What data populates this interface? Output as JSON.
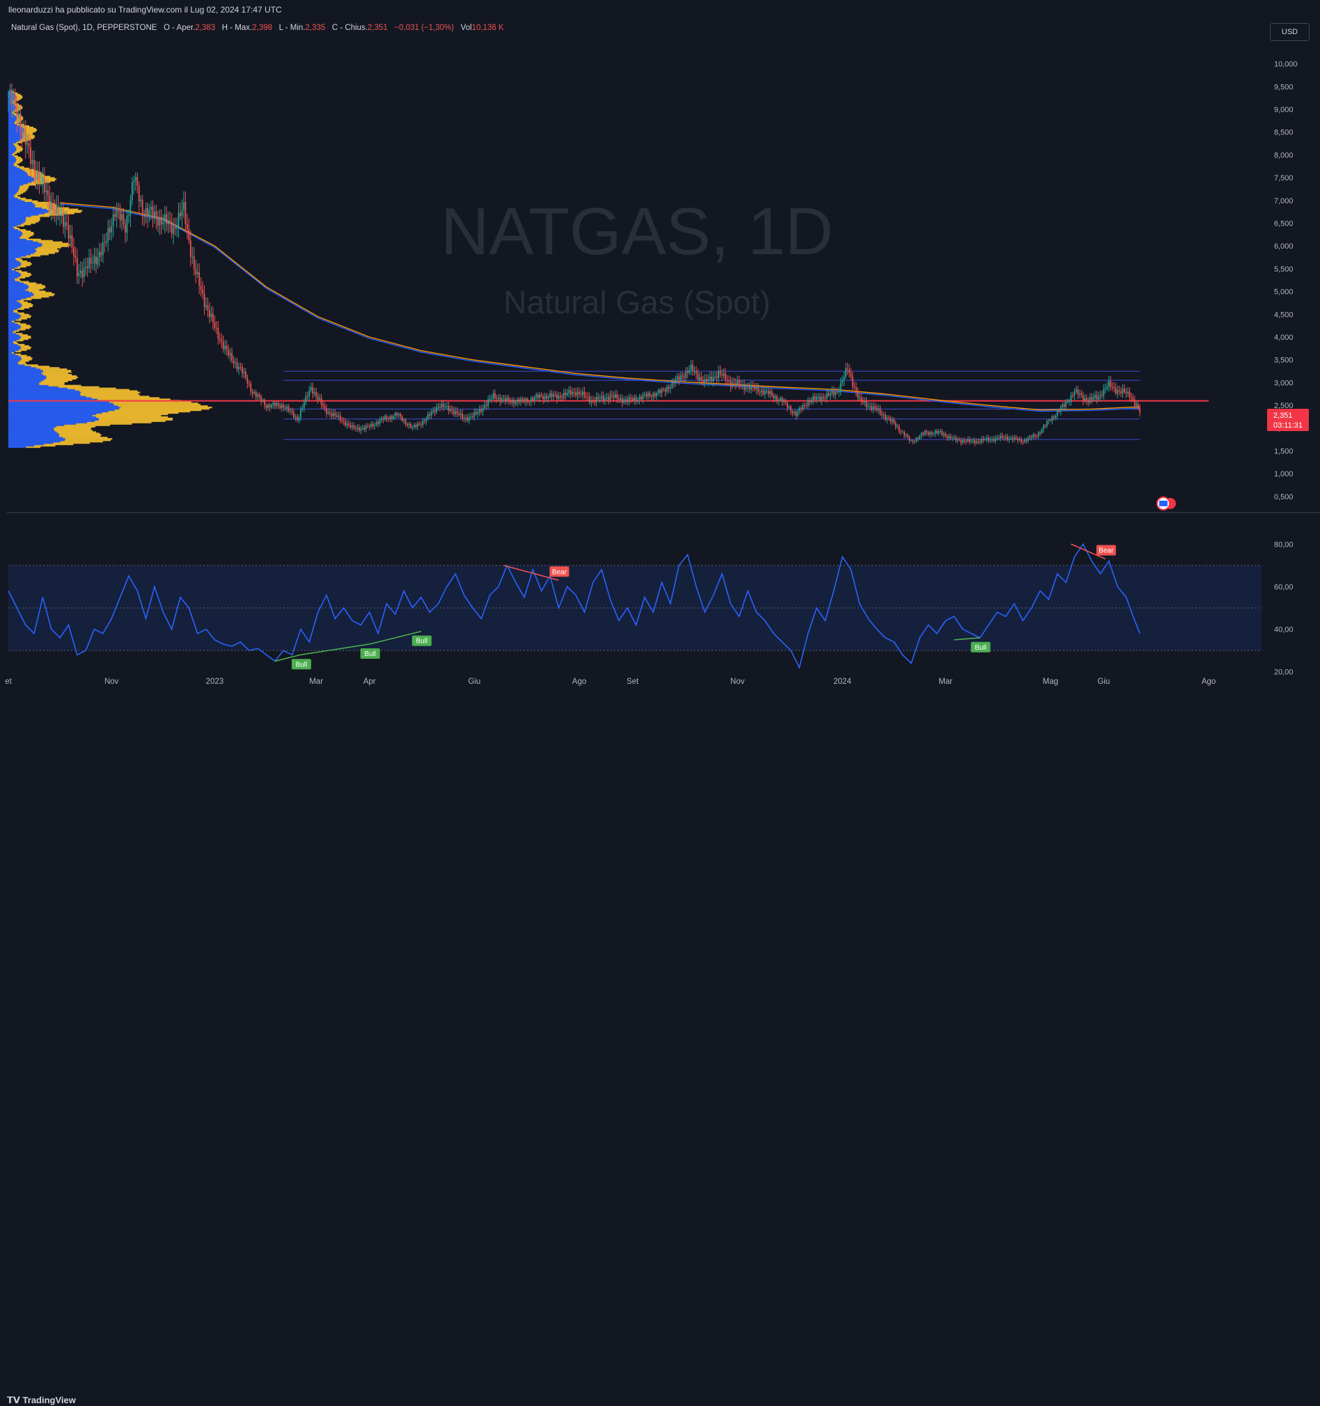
{
  "header": {
    "publish_line": "lleonarduzzi ha pubblicato su TradingView.com il Lug 02, 2024 17:47 UTC"
  },
  "legend": {
    "symbol": "Natural Gas (Spot), 1D, PEPPERSTONE",
    "open_label": "O - Aper.",
    "open": "2,383",
    "high_label": "H - Max.",
    "high": "2,398",
    "low_label": "L - Min.",
    "low": "2,335",
    "close_label": "C - Chius.",
    "close": "2,351",
    "change": "−0,031 (−1,30%)",
    "vol_label": "Vol",
    "vol": "10,136 K"
  },
  "currency": "USD",
  "watermark": {
    "ticker": "NATGAS, 1D",
    "name": "Natural Gas (Spot)"
  },
  "price_badge": {
    "price": "2,351",
    "countdown": "03:11:31"
  },
  "footer": {
    "logo_text": "TradingView"
  },
  "colors": {
    "background": "#131722",
    "up": "#26a69a",
    "down": "#ef5350",
    "rsi": "#2962ff",
    "ma_orange": "#ff9800",
    "ma_blue": "#2962ff",
    "vp_yellow": "#f9c22e",
    "vp_blue": "#2962ff",
    "range_line": "#3b4fd4",
    "hline_red": "#f23645"
  },
  "chart_data": [
    {
      "type": "candlestick",
      "title": "Natural Gas (Spot), 1D, PEPPERSTONE",
      "y_axis_ticks": [
        "0,500",
        "1,000",
        "1,500",
        "2,000",
        "2,500",
        "3,000",
        "3,500",
        "4,000",
        "4,500",
        "5,000",
        "5,500",
        "6,000",
        "6,500",
        "7,000",
        "7,500",
        "8,000",
        "8,500",
        "9,000",
        "9,500",
        "10,000"
      ],
      "ylim": [
        0.3,
        10.3
      ],
      "x_axis_ticks": [
        "et",
        "Nov",
        "2023",
        "Mar",
        "Apr",
        "Giu",
        "Ago",
        "Set",
        "Nov",
        "2024",
        "Mar",
        "Mag",
        "Giu",
        "Ago"
      ],
      "x_tick_days": [
        0,
        60,
        120,
        179,
        210,
        271,
        332,
        363,
        424,
        485,
        545,
        606,
        637,
        698
      ],
      "last_day": 658,
      "price_path": [
        [
          0,
          9.3
        ],
        [
          5,
          9.0
        ],
        [
          12,
          8.0
        ],
        [
          20,
          7.3
        ],
        [
          28,
          6.7
        ],
        [
          34,
          6.5
        ],
        [
          40,
          5.4
        ],
        [
          48,
          5.6
        ],
        [
          56,
          6.0
        ],
        [
          62,
          6.8
        ],
        [
          68,
          6.4
        ],
        [
          73,
          7.5
        ],
        [
          78,
          6.8
        ],
        [
          88,
          6.6
        ],
        [
          96,
          6.4
        ],
        [
          102,
          6.8
        ],
        [
          108,
          5.5
        ],
        [
          114,
          4.8
        ],
        [
          120,
          4.2
        ],
        [
          128,
          3.6
        ],
        [
          135,
          3.3
        ],
        [
          142,
          2.8
        ],
        [
          150,
          2.5
        ],
        [
          160,
          2.5
        ],
        [
          168,
          2.2
        ],
        [
          176,
          2.9
        ],
        [
          184,
          2.4
        ],
        [
          193,
          2.2
        ],
        [
          200,
          2.0
        ],
        [
          208,
          2.0
        ],
        [
          218,
          2.2
        ],
        [
          226,
          2.3
        ],
        [
          235,
          2.0
        ],
        [
          243,
          2.2
        ],
        [
          250,
          2.5
        ],
        [
          258,
          2.4
        ],
        [
          265,
          2.2
        ],
        [
          272,
          2.3
        ],
        [
          282,
          2.7
        ],
        [
          290,
          2.6
        ],
        [
          300,
          2.6
        ],
        [
          310,
          2.7
        ],
        [
          320,
          2.7
        ],
        [
          330,
          2.8
        ],
        [
          340,
          2.6
        ],
        [
          350,
          2.7
        ],
        [
          360,
          2.6
        ],
        [
          370,
          2.7
        ],
        [
          380,
          2.8
        ],
        [
          390,
          3.1
        ],
        [
          397,
          3.3
        ],
        [
          405,
          3.0
        ],
        [
          413,
          3.2
        ],
        [
          420,
          3.0
        ],
        [
          430,
          2.9
        ],
        [
          440,
          2.8
        ],
        [
          450,
          2.6
        ],
        [
          458,
          2.3
        ],
        [
          465,
          2.6
        ],
        [
          475,
          2.7
        ],
        [
          482,
          2.8
        ],
        [
          488,
          3.3
        ],
        [
          495,
          2.6
        ],
        [
          505,
          2.4
        ],
        [
          515,
          2.1
        ],
        [
          525,
          1.7
        ],
        [
          533,
          1.9
        ],
        [
          542,
          1.9
        ],
        [
          550,
          1.75
        ],
        [
          560,
          1.7
        ],
        [
          570,
          1.75
        ],
        [
          580,
          1.8
        ],
        [
          590,
          1.72
        ],
        [
          598,
          1.85
        ],
        [
          606,
          2.2
        ],
        [
          614,
          2.5
        ],
        [
          620,
          2.8
        ],
        [
          628,
          2.6
        ],
        [
          634,
          2.7
        ],
        [
          640,
          2.95
        ],
        [
          646,
          2.8
        ],
        [
          652,
          2.75
        ],
        [
          658,
          2.35
        ]
      ],
      "ma_orange_path": [
        [
          30,
          6.95
        ],
        [
          60,
          6.85
        ],
        [
          90,
          6.6
        ],
        [
          120,
          6.0
        ],
        [
          150,
          5.1
        ],
        [
          180,
          4.45
        ],
        [
          210,
          4.0
        ],
        [
          240,
          3.7
        ],
        [
          270,
          3.5
        ],
        [
          300,
          3.35
        ],
        [
          330,
          3.2
        ],
        [
          360,
          3.1
        ],
        [
          390,
          3.02
        ],
        [
          420,
          2.96
        ],
        [
          450,
          2.9
        ],
        [
          480,
          2.85
        ],
        [
          510,
          2.75
        ],
        [
          540,
          2.62
        ],
        [
          570,
          2.5
        ],
        [
          600,
          2.4
        ],
        [
          630,
          2.42
        ],
        [
          658,
          2.47
        ]
      ],
      "ma_blue_offset": -0.03,
      "hlines": [
        {
          "price": 3.25,
          "from_day": 160,
          "to_day": 658,
          "color": "#3b4fd4"
        },
        {
          "price": 3.05,
          "from_day": 160,
          "to_day": 658,
          "color": "#3b4fd4"
        },
        {
          "price": 2.42,
          "from_day": 160,
          "to_day": 658,
          "color": "#3b4fd4"
        },
        {
          "price": 2.2,
          "from_day": 160,
          "to_day": 658,
          "color": "#3b4fd4"
        },
        {
          "price": 1.75,
          "from_day": 160,
          "to_day": 658,
          "color": "#3b4fd4"
        },
        {
          "price": 2.6,
          "from_day": 0,
          "to_day": 698,
          "color": "#f23645"
        }
      ],
      "volume_profile_peaks": [
        [
          2.5,
          1.0
        ],
        [
          2.2,
          0.75
        ],
        [
          2.8,
          0.6
        ],
        [
          1.8,
          0.5
        ],
        [
          3.2,
          0.3
        ],
        [
          6.8,
          0.3
        ],
        [
          6.0,
          0.25
        ],
        [
          7.5,
          0.2
        ],
        [
          5.0,
          0.15
        ],
        [
          8.5,
          0.1
        ]
      ]
    },
    {
      "type": "line",
      "title": "RSI",
      "y_axis_ticks": [
        "20,00",
        "40,00",
        "60,00",
        "80,00"
      ],
      "ylim": [
        15,
        85
      ],
      "band": [
        30,
        70
      ],
      "midline": 50,
      "rsi_path": [
        [
          0,
          58
        ],
        [
          5,
          50
        ],
        [
          10,
          42
        ],
        [
          15,
          38
        ],
        [
          20,
          55
        ],
        [
          25,
          40
        ],
        [
          30,
          36
        ],
        [
          35,
          42
        ],
        [
          40,
          28
        ],
        [
          45,
          30
        ],
        [
          50,
          40
        ],
        [
          55,
          38
        ],
        [
          60,
          45
        ],
        [
          65,
          55
        ],
        [
          70,
          65
        ],
        [
          75,
          58
        ],
        [
          80,
          45
        ],
        [
          85,
          60
        ],
        [
          90,
          48
        ],
        [
          95,
          40
        ],
        [
          100,
          55
        ],
        [
          105,
          50
        ],
        [
          110,
          38
        ],
        [
          115,
          40
        ],
        [
          120,
          35
        ],
        [
          125,
          33
        ],
        [
          130,
          32
        ],
        [
          135,
          34
        ],
        [
          140,
          30
        ],
        [
          145,
          31
        ],
        [
          150,
          28
        ],
        [
          155,
          25
        ],
        [
          160,
          30
        ],
        [
          165,
          28
        ],
        [
          170,
          40
        ],
        [
          175,
          34
        ],
        [
          180,
          48
        ],
        [
          185,
          56
        ],
        [
          190,
          45
        ],
        [
          195,
          50
        ],
        [
          200,
          44
        ],
        [
          205,
          42
        ],
        [
          210,
          48
        ],
        [
          215,
          38
        ],
        [
          220,
          52
        ],
        [
          225,
          47
        ],
        [
          230,
          58
        ],
        [
          235,
          50
        ],
        [
          240,
          55
        ],
        [
          245,
          48
        ],
        [
          250,
          52
        ],
        [
          255,
          60
        ],
        [
          260,
          66
        ],
        [
          265,
          56
        ],
        [
          270,
          50
        ],
        [
          275,
          45
        ],
        [
          280,
          56
        ],
        [
          285,
          60
        ],
        [
          290,
          70
        ],
        [
          295,
          62
        ],
        [
          300,
          55
        ],
        [
          305,
          68
        ],
        [
          310,
          58
        ],
        [
          315,
          65
        ],
        [
          320,
          50
        ],
        [
          325,
          60
        ],
        [
          330,
          56
        ],
        [
          335,
          48
        ],
        [
          340,
          62
        ],
        [
          345,
          68
        ],
        [
          350,
          54
        ],
        [
          355,
          44
        ],
        [
          360,
          50
        ],
        [
          365,
          42
        ],
        [
          370,
          55
        ],
        [
          375,
          48
        ],
        [
          380,
          62
        ],
        [
          385,
          52
        ],
        [
          390,
          70
        ],
        [
          395,
          75
        ],
        [
          400,
          60
        ],
        [
          405,
          48
        ],
        [
          410,
          56
        ],
        [
          415,
          66
        ],
        [
          420,
          52
        ],
        [
          425,
          46
        ],
        [
          430,
          58
        ],
        [
          435,
          48
        ],
        [
          440,
          44
        ],
        [
          445,
          38
        ],
        [
          450,
          34
        ],
        [
          455,
          30
        ],
        [
          460,
          22
        ],
        [
          465,
          38
        ],
        [
          470,
          50
        ],
        [
          475,
          44
        ],
        [
          480,
          58
        ],
        [
          485,
          74
        ],
        [
          490,
          68
        ],
        [
          495,
          52
        ],
        [
          500,
          45
        ],
        [
          505,
          40
        ],
        [
          510,
          36
        ],
        [
          515,
          34
        ],
        [
          520,
          28
        ],
        [
          525,
          24
        ],
        [
          530,
          36
        ],
        [
          535,
          42
        ],
        [
          540,
          38
        ],
        [
          545,
          44
        ],
        [
          550,
          46
        ],
        [
          555,
          40
        ],
        [
          560,
          38
        ],
        [
          565,
          36
        ],
        [
          570,
          42
        ],
        [
          575,
          48
        ],
        [
          580,
          46
        ],
        [
          585,
          52
        ],
        [
          590,
          44
        ],
        [
          595,
          50
        ],
        [
          600,
          58
        ],
        [
          605,
          54
        ],
        [
          610,
          66
        ],
        [
          615,
          62
        ],
        [
          620,
          74
        ],
        [
          625,
          80
        ],
        [
          630,
          72
        ],
        [
          635,
          66
        ],
        [
          640,
          72
        ],
        [
          645,
          60
        ],
        [
          650,
          55
        ],
        [
          655,
          44
        ],
        [
          658,
          38
        ]
      ],
      "divergences": [
        {
          "from": [
            155,
            25
          ],
          "to": [
            170,
            28
          ],
          "label": "Bull",
          "color": "#4caf50"
        },
        {
          "from": [
            170,
            28
          ],
          "to": [
            210,
            33
          ],
          "label": "Bull",
          "color": "#4caf50"
        },
        {
          "from": [
            210,
            33
          ],
          "to": [
            240,
            39
          ],
          "label": "Bull",
          "color": "#4caf50"
        },
        {
          "from": [
            288,
            70
          ],
          "to": [
            320,
            63
          ],
          "label": "Bear",
          "color": "#ef5350"
        },
        {
          "from": [
            550,
            35
          ],
          "to": [
            565,
            36
          ],
          "label": "Bull",
          "color": "#4caf50"
        },
        {
          "from": [
            618,
            80
          ],
          "to": [
            638,
            73
          ],
          "label": "Bear",
          "color": "#ef5350"
        }
      ]
    }
  ]
}
